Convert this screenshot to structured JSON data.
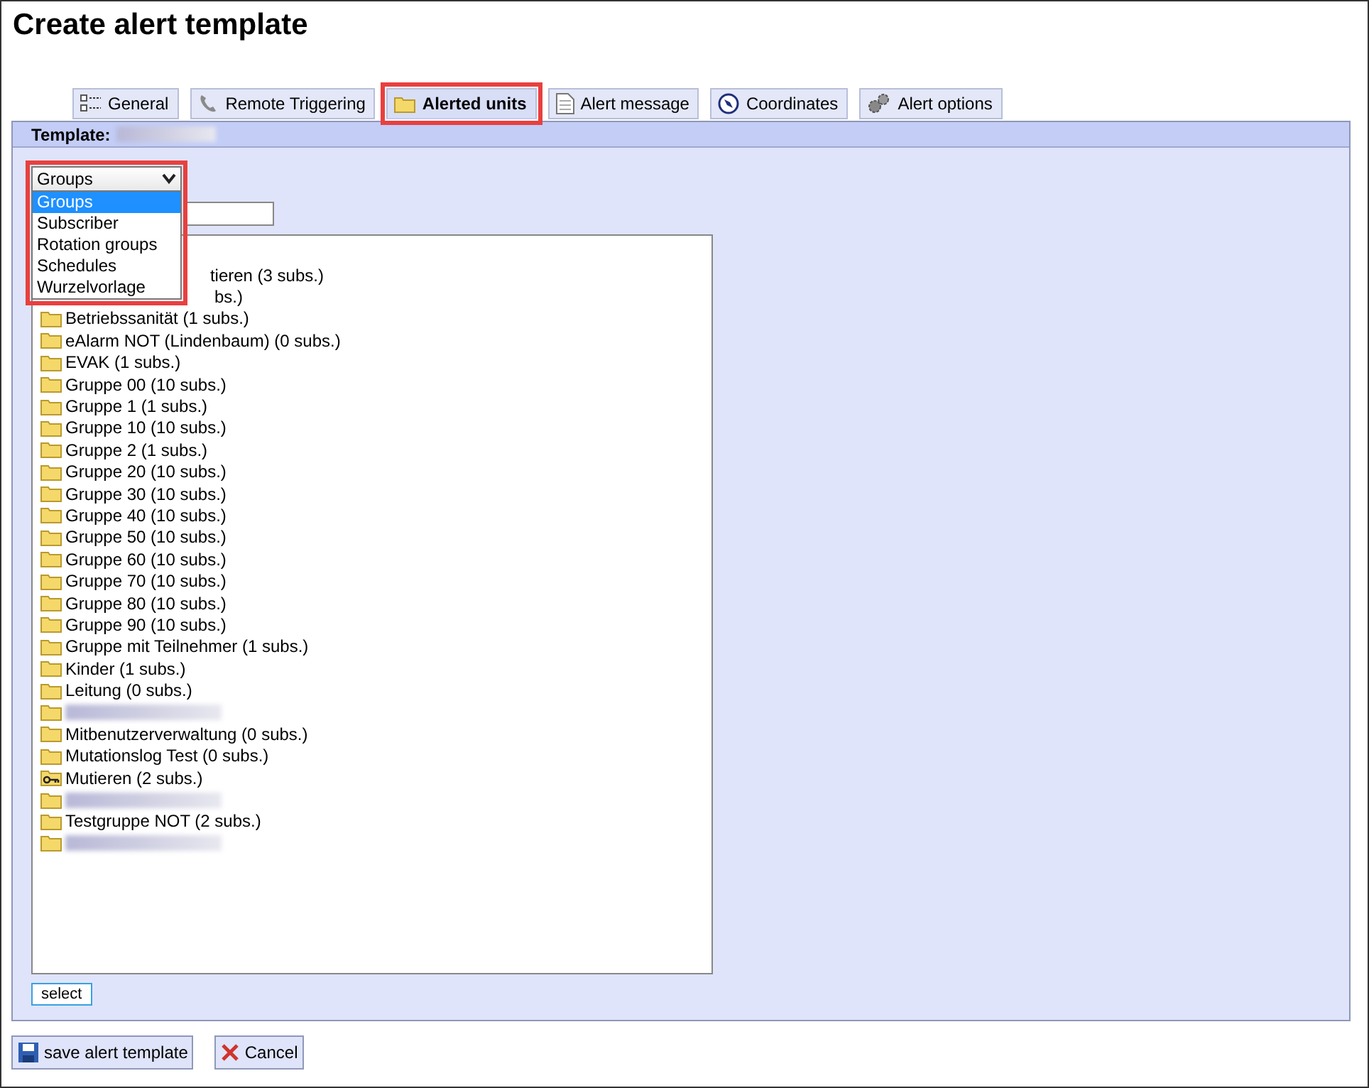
{
  "page": {
    "title": "Create alert template"
  },
  "tabs": [
    {
      "label": "General",
      "selected": false,
      "highlighted": false
    },
    {
      "label": "Remote Triggering",
      "selected": false,
      "highlighted": false
    },
    {
      "label": "Alerted units",
      "selected": true,
      "highlighted": true
    },
    {
      "label": "Alert message",
      "selected": false,
      "highlighted": false
    },
    {
      "label": "Coordinates",
      "selected": false,
      "highlighted": false
    },
    {
      "label": "Alert options",
      "selected": false,
      "highlighted": false
    }
  ],
  "template": {
    "label": "Template:",
    "value_redacted": true
  },
  "unit_type_select": {
    "value": "Groups",
    "expanded": true,
    "highlighted": true,
    "options": [
      {
        "label": "Groups",
        "selected": true
      },
      {
        "label": "Subscriber",
        "selected": false
      },
      {
        "label": "Rotation groups",
        "selected": false
      },
      {
        "label": "Schedules",
        "selected": false
      },
      {
        "label": "Wurzelvorlage",
        "selected": false
      }
    ]
  },
  "tree": [
    {
      "label": "tieren (3 subs.)",
      "covered": true,
      "redacted": false
    },
    {
      "label": "bs.)",
      "covered": true,
      "redacted": false
    },
    {
      "label": "Betriebssanität (1 subs.)",
      "kind": "folder",
      "covered": false,
      "redacted": false
    },
    {
      "label": "eAlarm NOT (Lindenbaum) (0 subs.)",
      "kind": "folder",
      "covered": false,
      "redacted": false
    },
    {
      "label": "EVAK (1 subs.)",
      "kind": "folder",
      "covered": false,
      "redacted": false
    },
    {
      "label": "Gruppe 00 (10 subs.)",
      "kind": "folder",
      "covered": false,
      "redacted": false
    },
    {
      "label": "Gruppe 1 (1 subs.)",
      "kind": "folder",
      "covered": false,
      "redacted": false
    },
    {
      "label": "Gruppe 10 (10 subs.)",
      "kind": "folder",
      "covered": false,
      "redacted": false
    },
    {
      "label": "Gruppe 2 (1 subs.)",
      "kind": "folder",
      "covered": false,
      "redacted": false
    },
    {
      "label": "Gruppe 20 (10 subs.)",
      "kind": "folder",
      "covered": false,
      "redacted": false
    },
    {
      "label": "Gruppe 30 (10 subs.)",
      "kind": "folder",
      "covered": false,
      "redacted": false
    },
    {
      "label": "Gruppe 40 (10 subs.)",
      "kind": "folder",
      "covered": false,
      "redacted": false
    },
    {
      "label": "Gruppe 50 (10 subs.)",
      "kind": "folder",
      "covered": false,
      "redacted": false
    },
    {
      "label": "Gruppe 60 (10 subs.)",
      "kind": "folder",
      "covered": false,
      "redacted": false
    },
    {
      "label": "Gruppe 70 (10 subs.)",
      "kind": "folder",
      "covered": false,
      "redacted": false
    },
    {
      "label": "Gruppe 80 (10 subs.)",
      "kind": "folder",
      "covered": false,
      "redacted": false
    },
    {
      "label": "Gruppe 90 (10 subs.)",
      "kind": "folder",
      "covered": false,
      "redacted": false
    },
    {
      "label": "Gruppe mit Teilnehmer (1 subs.)",
      "kind": "folder",
      "covered": false,
      "redacted": false
    },
    {
      "label": "Kinder (1 subs.)",
      "kind": "folder",
      "covered": false,
      "redacted": false
    },
    {
      "label": "Leitung (0 subs.)",
      "kind": "folder",
      "covered": false,
      "redacted": false
    },
    {
      "kind": "folder",
      "covered": false,
      "redacted": true
    },
    {
      "label": "Mitbenutzerverwaltung (0 subs.)",
      "kind": "folder",
      "covered": false,
      "redacted": false
    },
    {
      "label": "Mutationslog Test (0 subs.)",
      "kind": "folder",
      "covered": false,
      "redacted": false
    },
    {
      "label": "Mutieren (2 subs.)",
      "kind": "key",
      "covered": false,
      "redacted": false
    },
    {
      "kind": "folder",
      "covered": false,
      "redacted": true
    },
    {
      "label": "Testgruppe NOT (2 subs.)",
      "kind": "folder",
      "covered": false,
      "redacted": false
    },
    {
      "kind": "folder",
      "covered": false,
      "redacted": true
    }
  ],
  "select_button": {
    "label": "select"
  },
  "buttons": [
    {
      "label": "save alert template",
      "kind": "save"
    },
    {
      "label": "Cancel",
      "kind": "cancel"
    }
  ]
}
